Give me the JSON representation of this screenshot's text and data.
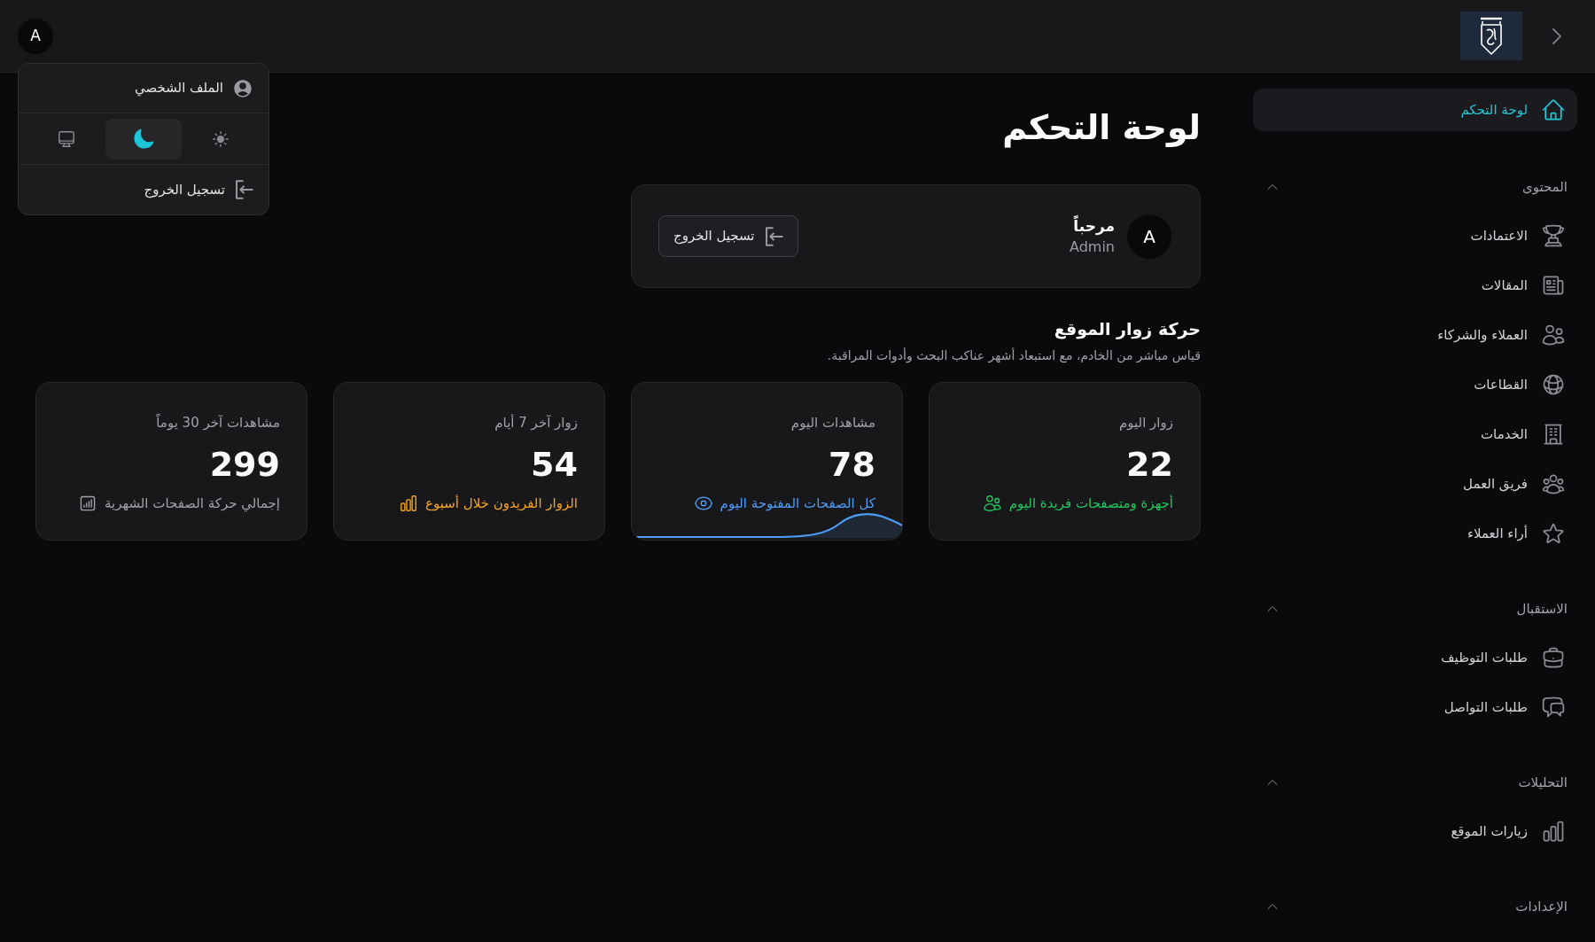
{
  "header": {
    "avatar": "A"
  },
  "user_menu": {
    "profile": "الملف الشخصي",
    "theme_options": [
      {
        "kind": "light",
        "selected": false
      },
      {
        "kind": "dark",
        "selected": true
      },
      {
        "kind": "system",
        "selected": false
      }
    ],
    "logout": "تسجيل الخروج"
  },
  "sidebar": {
    "items": [
      {
        "label": "لوحة التحكم",
        "selected": true
      }
    ],
    "sections": [
      {
        "title": "المحتوى",
        "expanded": true,
        "items": [
          {
            "label": "الاعتمادات",
            "selected": false
          },
          {
            "label": "المقالات",
            "selected": false
          },
          {
            "label": "العملاء والشركاء",
            "selected": false
          },
          {
            "label": "القطاعات",
            "selected": false
          },
          {
            "label": "الخدمات",
            "selected": false
          },
          {
            "label": "فريق العمل",
            "selected": false
          },
          {
            "label": "أراء العملاء",
            "selected": false
          }
        ]
      },
      {
        "title": "الاستقبال",
        "expanded": true,
        "items": [
          {
            "label": "طلبات التوظيف",
            "selected": false
          },
          {
            "label": "طلبات التواصل",
            "selected": false
          }
        ]
      },
      {
        "title": "التحليلات",
        "expanded": true,
        "items": [
          {
            "label": "زيارات الموقع",
            "selected": false
          }
        ]
      },
      {
        "title": "الإعدادات",
        "expanded": true
      }
    ]
  },
  "page_title": "لوحة التحكم",
  "welcome_card": {
    "avatar": "A",
    "greeting": "مرحباً",
    "name": "Admin",
    "logout_button": "تسجيل الخروج"
  },
  "traffic": {
    "title": "حركة زوار الموقع",
    "subtitle": "قياس مباشر من الخادم، مع استبعاد أشهر عناكب البحث وأدوات المراقبة.",
    "cards": [
      {
        "kind": "plain",
        "label": "زوار اليوم",
        "value": "22",
        "note": "أجهزة ومتصفحات فريدة اليوم",
        "color": "#22c55e"
      },
      {
        "kind": "trend",
        "label": "مشاهدات اليوم",
        "value": "78",
        "note": "كل الصفحات المفتوحة اليوم",
        "color": "#4f9cf9"
      },
      {
        "kind": "plain",
        "label": "زوار آخر 7 أيام",
        "value": "54",
        "note": "الزوار الفريدون خلال أسبوع",
        "color": "#f5a524"
      },
      {
        "kind": "plain",
        "label": "مشاهدات آخر 30 يوماً",
        "value": "299",
        "note": "إجمالي حركة الصفحات الشهرية",
        "color": "#a1a1aa"
      }
    ]
  }
}
